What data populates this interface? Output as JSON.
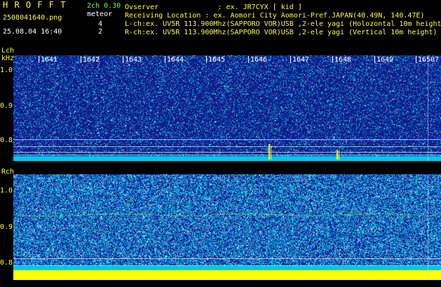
{
  "header": {
    "app_name": "H R O F F T",
    "version": "2ch 0.30",
    "meteor_label": "meteor",
    "filename": "2508041640.png",
    "datetime": "25.08.04 16:40",
    "count_l": "4",
    "count_r": "2",
    "observer": "Ovserver              : ex. JR7CYX [ kid ]",
    "location": "Receiving Location : ex. Aomori City Aomori-Pref.JAPAN(40.49N, 140.47E)",
    "lch_info": "L-ch:ex. UV5R 113.900Mhz(SAPPORO VOR)USB ,2-ele yagi (Holozontal 10m height)",
    "rch_info": "R-ch:ex. UV5R 113.900Mhz(SAPPORO VOR)USB ,2-ele yagi (Vertical 10m height)"
  },
  "lch": {
    "label": "Lch",
    "unit": "kHz",
    "yticks": [
      "1.0",
      "0.9",
      "0.8"
    ]
  },
  "rch": {
    "label": "Rch",
    "yticks": [
      "1.0",
      "0.9",
      "0.8"
    ]
  },
  "time_axis": [
    "1641",
    "1642",
    "1643",
    "1644",
    "1645",
    "1646",
    "1647",
    "1648",
    "1649",
    "1650"
  ],
  "time_axis_last_suffix": "7",
  "colors": {
    "background": "#000000",
    "panel": "#0e1f8c",
    "noise_high": "#00c8e8",
    "signal": "#ffff00",
    "text_yellow": "#ffff33",
    "text_green": "#66ff44"
  }
}
